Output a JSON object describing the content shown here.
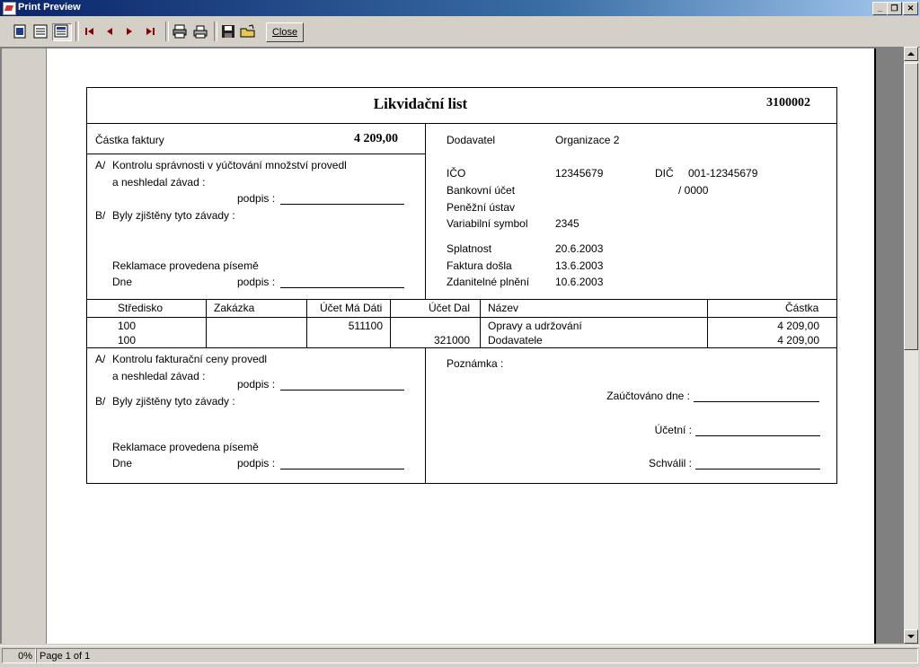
{
  "window": {
    "title": "Print Preview"
  },
  "toolbar": {
    "close_label": "Close"
  },
  "status": {
    "zoom": "0%",
    "page": "Page 1 of 1"
  },
  "doc": {
    "title": "Likvidační list",
    "number": "3100002",
    "amount_label": "Částka faktury",
    "amount_value": "4 209,00",
    "check1": {
      "a_prefix": "A/",
      "a_text": "Kontrolu správnosti v yúčtování množství provedl",
      "a_text2": "a neshledal závad :",
      "sign_label": "podpis :",
      "b_prefix": "B/",
      "b_text": "Byly zjištěny tyto závady :",
      "claim": "Reklamace provedena písemě",
      "date_label": "Dne",
      "sign_label2": "podpis :"
    },
    "supplier": {
      "label": "Dodavatel",
      "value": "Organizace 2",
      "ico_label": "IČO",
      "ico_value": "12345679",
      "dic_label": "DIČ",
      "dic_value": "001-12345679",
      "bank_label": "Bankovní účet",
      "bank_value": "/  0000",
      "money_label": "Peněžní ústav",
      "vs_label": "Variabilní symbol",
      "vs_value": "2345",
      "due_label": "Splatnost",
      "due_value": "20.6.2003",
      "arrived_label": "Faktura došla",
      "arrived_value": "13.6.2003",
      "taxable_label": "Zdanitelné plnění",
      "taxable_value": "10.6.2003"
    },
    "table": {
      "headers": [
        "Středisko",
        "Zakázka",
        "Účet Má Dáti",
        "Účet Dal",
        "Název",
        "Částka"
      ],
      "rows": [
        {
          "center": "100",
          "order": "",
          "debit": "511100",
          "credit": "",
          "name": "Opravy a udržování",
          "amount": "4 209,00"
        },
        {
          "center": "100",
          "order": "",
          "debit": "",
          "credit": "321000",
          "name": "Dodavatele",
          "amount": "4 209,00"
        }
      ]
    },
    "check2": {
      "a_prefix": "A/",
      "a_text": "Kontrolu fakturační ceny provedl",
      "a_text2": "a neshledal závad :",
      "sign_label": "podpis :",
      "b_prefix": "B/",
      "b_text": "Byly zjištěny tyto závady :",
      "claim": "Reklamace provedena písemě",
      "date_label": "Dne",
      "sign_label2": "podpis :"
    },
    "note_label": "Poznámka :",
    "booked_label": "Zaúčtováno dne :",
    "accountant_label": "Účetní :",
    "approved_label": "Schválil :"
  }
}
